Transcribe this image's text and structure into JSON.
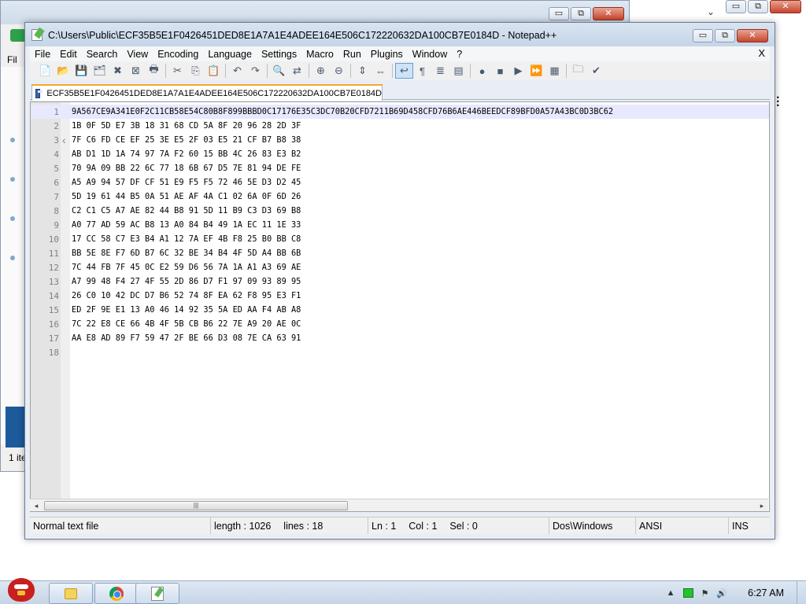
{
  "background_window": {
    "menu_partial": "Fil",
    "items_partial": "1 ite",
    "caption_buttons": [
      "▭",
      "⧉",
      "✕"
    ]
  },
  "background_window2": {
    "caption_buttons": [
      "▭",
      "⧉",
      "✕"
    ]
  },
  "notepad": {
    "title": "C:\\Users\\Public\\ECF35B5E1F0426451DED8E1A7A1E4ADEE164E506C172220632DA100CB7E0184D - Notepad++",
    "caption_buttons": [
      "▭",
      "⧉",
      "✕"
    ],
    "menu": [
      "File",
      "Edit",
      "Search",
      "View",
      "Encoding",
      "Language",
      "Settings",
      "Macro",
      "Run",
      "Plugins",
      "Window",
      "?"
    ],
    "menu_close": "X",
    "toolbar_icons": [
      "new-file-icon",
      "open-file-icon",
      "save-icon",
      "save-all-icon",
      "close-icon",
      "close-all-icon",
      "print-icon",
      "|",
      "cut-icon",
      "copy-icon",
      "paste-icon",
      "|",
      "undo-icon",
      "redo-icon",
      "|",
      "find-icon",
      "replace-icon",
      "|",
      "zoom-in-icon",
      "zoom-out-icon",
      "|",
      "sync-vertical-icon",
      "sync-horizontal-icon",
      "|",
      "word-wrap-icon",
      "show-all-chars-icon",
      "indent-guide-icon",
      "doc-map-icon",
      "|",
      "record-macro-icon",
      "stop-record-icon",
      "play-macro-icon",
      "run-macro-multiple-icon",
      "save-macro-icon",
      "|",
      "folder-workspace-icon",
      "spellcheck-icon"
    ],
    "toolbar_glyphs": [
      "📄",
      "📂",
      "💾",
      "🗂",
      "✖",
      "⊠",
      "🖶",
      "|",
      "✂",
      "⎘",
      "📋",
      "|",
      "↶",
      "↷",
      "|",
      "🔍",
      "⇄",
      "|",
      "⊕",
      "⊖",
      "|",
      "⇕",
      "⇔",
      "|",
      "↩",
      "¶",
      "≣",
      "▤",
      "|",
      "●",
      "■",
      "▶",
      "⏩",
      "▦",
      "|",
      "🗀",
      "✔"
    ],
    "active_tab": "ECF35B5E1F0426451DED8E1A7A1E4ADEE164E506C172220632DA100CB7E0184D",
    "lines": [
      "9A567CE9A341E0F2C11CB58E54C80B8F899BBBD0C17176E35C3DC70B20CFD7211B69D458CFD76B6AE446BEEDCF89BFD0A57A43BC0D3BC62",
      "1B 0F 5D E7 3B 18 31 68 CD 5A 8F 20 96 28 2D 3F",
      "7F C6 FD CE EF 25 3E E5 2F 03 E5 21 CF B7 B8 38",
      "AB D1 1D 1A 74 97 7A F2 60 15 BB 4C 26 83 E3 B2",
      "70 9A 09 BB 22 6C 77 18 6B 67 D5 7E 81 94 DE FE",
      "A5 A9 94 57 DF CF 51 E9 F5 F5 72 46 5E D3 D2 45",
      "5D 19 61 44 B5 0A 51 AE AF 4A C1 02 6A 0F 6D 26",
      "C2 C1 C5 A7 AE 82 44 B8 91 5D 11 B9 C3 D3 69 B8",
      "A0 77 AD 59 AC B8 13 A0 84 B4 49 1A EC 11 1E 33",
      "17 CC 58 C7 E3 B4 A1 12 7A EF 4B F8 25 B0 BB C8",
      "BB 5E 8E F7 6D B7 6C 32 BE 34 B4 4F 5D A4 BB 6B",
      "7C 44 FB 7F 45 0C E2 59 D6 56 7A 1A A1 A3 69 AE",
      "A7 99 48 F4 27 4F 55 2D 86 D7 F1 97 09 93 89 95",
      "26 C0 10 42 DC D7 B6 52 74 8F EA 62 F8 95 E3 F1",
      "ED 2F 9E E1 13 A0 46 14 92 35 5A ED AA F4 AB A8",
      "7C 22 E8 CE 66 4B 4F 5B CB B6 22 7E A9 20 AE 0C",
      "AA E8 AD 89 F7 59 47 2F BE 66 D3 08 7E CA 63 91",
      ""
    ],
    "scrollbar": {
      "left_arrow": "◂",
      "right_arrow": "▸",
      "thumb_grip": "|||"
    },
    "status": {
      "file_type": "Normal text file",
      "length": "length : 1026",
      "lines": "lines : 18",
      "ln": "Ln : 1",
      "col": "Col : 1",
      "sel": "Sel : 0",
      "eol": "Dos\\Windows",
      "encoding": "ANSI",
      "mode": "INS"
    }
  },
  "taskbar": {
    "clock": "6:27 AM",
    "tray_arrow": "▲",
    "volume_icon": "🔊",
    "flag_icon": "⚑",
    "apps": [
      "folder-icon",
      "chrome-icon",
      "notepad-plus-plus-icon"
    ]
  },
  "colors": {
    "title_bar": "#c5d5e8",
    "tab_accent": "#f5a623",
    "close_button": "#c6452b",
    "current_line": "#e8e8ff"
  }
}
